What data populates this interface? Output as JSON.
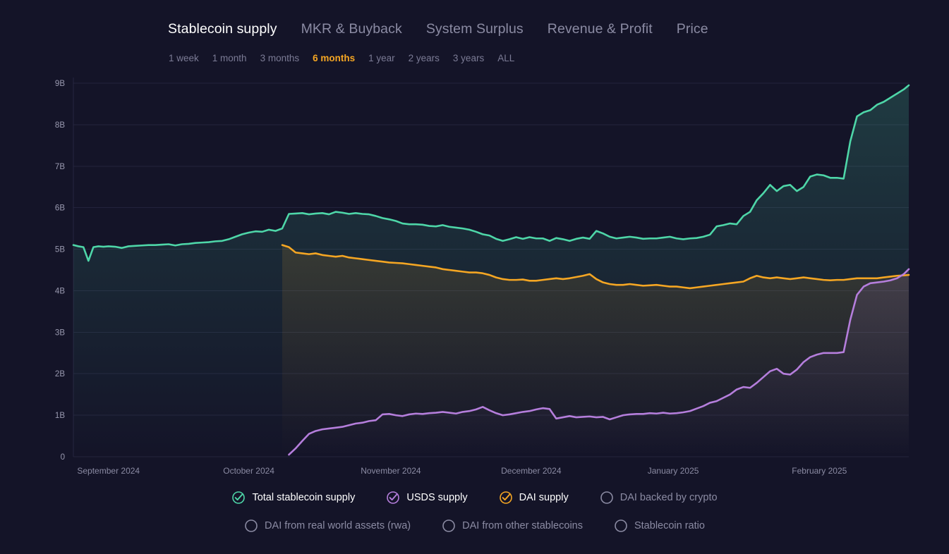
{
  "tabs": [
    {
      "label": "Stablecoin supply",
      "active": true
    },
    {
      "label": "MKR & Buyback",
      "active": false
    },
    {
      "label": "System Surplus",
      "active": false
    },
    {
      "label": "Revenue & Profit",
      "active": false
    },
    {
      "label": "Price",
      "active": false
    }
  ],
  "ranges": [
    {
      "label": "1 week",
      "active": false
    },
    {
      "label": "1 month",
      "active": false
    },
    {
      "label": "3 months",
      "active": false
    },
    {
      "label": "6 months",
      "active": true
    },
    {
      "label": "1 year",
      "active": false
    },
    {
      "label": "2 years",
      "active": false
    },
    {
      "label": "3 years",
      "active": false
    },
    {
      "label": "ALL",
      "active": false
    }
  ],
  "legend": {
    "row1": [
      {
        "label": "Total stablecoin supply",
        "active": true,
        "color": "#4ed6a8",
        "icon": "check-circle-icon"
      },
      {
        "label": "USDS supply",
        "active": true,
        "color": "#b57edc",
        "icon": "check-circle-icon"
      },
      {
        "label": "DAI supply",
        "active": true,
        "color": "#f5a623",
        "icon": "check-circle-icon"
      },
      {
        "label": "DAI backed by crypto",
        "active": false,
        "color": "#8b8ba3",
        "icon": "empty-circle-icon"
      }
    ],
    "row2": [
      {
        "label": "DAI from real world assets (rwa)",
        "active": false,
        "color": "#8b8ba3",
        "icon": "empty-circle-icon"
      },
      {
        "label": "DAI from other stablecoins",
        "active": false,
        "color": "#8b8ba3",
        "icon": "empty-circle-icon"
      },
      {
        "label": "Stablecoin ratio",
        "active": false,
        "color": "#8b8ba3",
        "icon": "empty-circle-icon"
      }
    ]
  },
  "colors": {
    "background": "#141428",
    "total": "#4ed6a8",
    "usds": "#b57edc",
    "dai": "#f5a623",
    "accent": "#f5a623",
    "grid": "#23233c",
    "axis_text": "#9a9ab0"
  },
  "chart_data": {
    "type": "line",
    "title": "Stablecoin supply",
    "xlabel": "",
    "ylabel": "",
    "ylim": [
      0,
      9
    ],
    "yticks": [
      0,
      1,
      2,
      3,
      4,
      5,
      6,
      7,
      8,
      9
    ],
    "ytick_labels": [
      "0",
      "1B",
      "2B",
      "3B",
      "4B",
      "5B",
      "6B",
      "7B",
      "8B",
      "9B"
    ],
    "xtick_labels": [
      "September 2024",
      "October 2024",
      "November 2024",
      "December 2024",
      "January 2025",
      "February 2025"
    ],
    "xtick_positions": [
      0.042,
      0.21,
      0.38,
      0.548,
      0.718,
      0.893
    ],
    "units": "USD billions",
    "grid": true,
    "legend_position": "bottom",
    "series": [
      {
        "name": "Total stablecoin supply",
        "color": "#4ed6a8",
        "x": [
          0,
          0.006,
          0.012,
          0.018,
          0.024,
          0.03,
          0.036,
          0.042,
          0.05,
          0.058,
          0.066,
          0.074,
          0.082,
          0.09,
          0.098,
          0.106,
          0.114,
          0.122,
          0.13,
          0.138,
          0.146,
          0.154,
          0.162,
          0.17,
          0.178,
          0.186,
          0.194,
          0.202,
          0.21,
          0.218,
          0.226,
          0.234,
          0.242,
          0.25,
          0.258,
          0.266,
          0.274,
          0.282,
          0.29,
          0.298,
          0.306,
          0.314,
          0.322,
          0.33,
          0.338,
          0.346,
          0.354,
          0.362,
          0.37,
          0.378,
          0.386,
          0.394,
          0.402,
          0.41,
          0.418,
          0.426,
          0.434,
          0.442,
          0.45,
          0.458,
          0.466,
          0.474,
          0.482,
          0.49,
          0.498,
          0.506,
          0.514,
          0.522,
          0.53,
          0.538,
          0.546,
          0.554,
          0.562,
          0.57,
          0.578,
          0.586,
          0.594,
          0.602,
          0.61,
          0.618,
          0.626,
          0.634,
          0.642,
          0.65,
          0.658,
          0.666,
          0.674,
          0.682,
          0.69,
          0.698,
          0.706,
          0.714,
          0.722,
          0.73,
          0.738,
          0.746,
          0.754,
          0.762,
          0.77,
          0.778,
          0.786,
          0.794,
          0.802,
          0.81,
          0.818,
          0.826,
          0.834,
          0.842,
          0.85,
          0.858,
          0.866,
          0.874,
          0.882,
          0.89,
          0.898,
          0.906,
          0.914,
          0.922,
          0.93,
          0.938,
          0.946,
          0.954,
          0.962,
          0.97,
          0.978,
          0.986,
          0.994,
          1.0
        ],
        "y": [
          5.1,
          5.07,
          5.05,
          4.72,
          5.05,
          5.07,
          5.06,
          5.07,
          5.06,
          5.03,
          5.07,
          5.08,
          5.09,
          5.1,
          5.1,
          5.11,
          5.12,
          5.09,
          5.12,
          5.13,
          5.15,
          5.16,
          5.17,
          5.19,
          5.2,
          5.24,
          5.3,
          5.36,
          5.4,
          5.43,
          5.42,
          5.47,
          5.44,
          5.5,
          5.85,
          5.86,
          5.87,
          5.84,
          5.86,
          5.87,
          5.84,
          5.9,
          5.88,
          5.85,
          5.87,
          5.85,
          5.84,
          5.8,
          5.75,
          5.72,
          5.68,
          5.62,
          5.6,
          5.6,
          5.59,
          5.56,
          5.55,
          5.58,
          5.54,
          5.52,
          5.5,
          5.47,
          5.42,
          5.36,
          5.33,
          5.25,
          5.2,
          5.24,
          5.29,
          5.25,
          5.29,
          5.26,
          5.26,
          5.2,
          5.27,
          5.24,
          5.2,
          5.25,
          5.28,
          5.25,
          5.44,
          5.38,
          5.3,
          5.26,
          5.28,
          5.3,
          5.28,
          5.25,
          5.26,
          5.26,
          5.28,
          5.3,
          5.26,
          5.24,
          5.26,
          5.27,
          5.3,
          5.35,
          5.55,
          5.58,
          5.62,
          5.6,
          5.8,
          5.9,
          6.18,
          6.35,
          6.55,
          6.4,
          6.52,
          6.55,
          6.4,
          6.5,
          6.75,
          6.8,
          6.78,
          6.72,
          6.72,
          6.7,
          7.6,
          8.2,
          8.3,
          8.35,
          8.48,
          8.55,
          8.65,
          8.75,
          8.85,
          8.95
        ]
      },
      {
        "name": "DAI supply",
        "color": "#f5a623",
        "x": [
          0.25,
          0.258,
          0.266,
          0.274,
          0.282,
          0.29,
          0.298,
          0.306,
          0.314,
          0.322,
          0.33,
          0.338,
          0.346,
          0.354,
          0.362,
          0.37,
          0.378,
          0.386,
          0.394,
          0.402,
          0.41,
          0.418,
          0.426,
          0.434,
          0.442,
          0.45,
          0.458,
          0.466,
          0.474,
          0.482,
          0.49,
          0.498,
          0.506,
          0.514,
          0.522,
          0.53,
          0.538,
          0.546,
          0.554,
          0.562,
          0.57,
          0.578,
          0.586,
          0.594,
          0.602,
          0.61,
          0.618,
          0.626,
          0.634,
          0.642,
          0.65,
          0.658,
          0.666,
          0.674,
          0.682,
          0.69,
          0.698,
          0.706,
          0.714,
          0.722,
          0.73,
          0.738,
          0.746,
          0.754,
          0.762,
          0.77,
          0.778,
          0.786,
          0.794,
          0.802,
          0.81,
          0.818,
          0.826,
          0.834,
          0.842,
          0.85,
          0.858,
          0.866,
          0.874,
          0.882,
          0.89,
          0.898,
          0.906,
          0.914,
          0.922,
          0.93,
          0.938,
          0.946,
          0.954,
          0.962,
          0.97,
          0.978,
          0.986,
          0.994,
          1.0
        ],
        "y": [
          5.1,
          5.05,
          4.92,
          4.9,
          4.88,
          4.9,
          4.86,
          4.84,
          4.82,
          4.84,
          4.8,
          4.78,
          4.76,
          4.74,
          4.72,
          4.7,
          4.68,
          4.67,
          4.66,
          4.64,
          4.62,
          4.6,
          4.58,
          4.56,
          4.52,
          4.5,
          4.48,
          4.46,
          4.44,
          4.44,
          4.42,
          4.38,
          4.32,
          4.28,
          4.26,
          4.26,
          4.27,
          4.24,
          4.24,
          4.26,
          4.28,
          4.3,
          4.28,
          4.3,
          4.33,
          4.36,
          4.4,
          4.28,
          4.2,
          4.16,
          4.14,
          4.14,
          4.16,
          4.14,
          4.12,
          4.13,
          4.14,
          4.12,
          4.1,
          4.1,
          4.08,
          4.06,
          4.08,
          4.1,
          4.12,
          4.14,
          4.16,
          4.18,
          4.2,
          4.22,
          4.3,
          4.36,
          4.32,
          4.3,
          4.32,
          4.3,
          4.28,
          4.3,
          4.32,
          4.3,
          4.28,
          4.26,
          4.25,
          4.26,
          4.26,
          4.28,
          4.3,
          4.3,
          4.3,
          4.3,
          4.32,
          4.34,
          4.36,
          4.37,
          4.38
        ]
      },
      {
        "name": "USDS supply",
        "color": "#b57edc",
        "x": [
          0.258,
          0.266,
          0.274,
          0.282,
          0.29,
          0.298,
          0.306,
          0.314,
          0.322,
          0.33,
          0.338,
          0.346,
          0.354,
          0.362,
          0.37,
          0.378,
          0.386,
          0.394,
          0.402,
          0.41,
          0.418,
          0.426,
          0.434,
          0.442,
          0.45,
          0.458,
          0.466,
          0.474,
          0.482,
          0.49,
          0.498,
          0.506,
          0.514,
          0.522,
          0.53,
          0.538,
          0.546,
          0.554,
          0.562,
          0.57,
          0.578,
          0.586,
          0.594,
          0.602,
          0.61,
          0.618,
          0.626,
          0.634,
          0.642,
          0.65,
          0.658,
          0.666,
          0.674,
          0.682,
          0.69,
          0.698,
          0.706,
          0.714,
          0.722,
          0.73,
          0.738,
          0.746,
          0.754,
          0.762,
          0.77,
          0.778,
          0.786,
          0.794,
          0.802,
          0.81,
          0.818,
          0.826,
          0.834,
          0.842,
          0.85,
          0.858,
          0.866,
          0.874,
          0.882,
          0.89,
          0.898,
          0.906,
          0.914,
          0.922,
          0.93,
          0.938,
          0.946,
          0.954,
          0.962,
          0.97,
          0.978,
          0.986,
          0.994,
          1.0
        ],
        "y": [
          0.05,
          0.2,
          0.38,
          0.55,
          0.62,
          0.66,
          0.68,
          0.7,
          0.72,
          0.76,
          0.8,
          0.82,
          0.86,
          0.88,
          1.02,
          1.03,
          1.0,
          0.98,
          1.02,
          1.04,
          1.03,
          1.05,
          1.06,
          1.08,
          1.06,
          1.04,
          1.08,
          1.1,
          1.14,
          1.2,
          1.12,
          1.05,
          1.0,
          1.02,
          1.05,
          1.08,
          1.1,
          1.14,
          1.17,
          1.15,
          0.92,
          0.95,
          0.98,
          0.95,
          0.96,
          0.97,
          0.95,
          0.96,
          0.9,
          0.95,
          1.0,
          1.02,
          1.03,
          1.03,
          1.05,
          1.04,
          1.06,
          1.04,
          1.05,
          1.07,
          1.1,
          1.16,
          1.22,
          1.3,
          1.34,
          1.42,
          1.5,
          1.62,
          1.68,
          1.66,
          1.78,
          1.92,
          2.06,
          2.12,
          2.0,
          1.98,
          2.1,
          2.28,
          2.4,
          2.46,
          2.5,
          2.5,
          2.5,
          2.52,
          3.3,
          3.9,
          4.1,
          4.18,
          4.2,
          4.22,
          4.25,
          4.3,
          4.4,
          4.52
        ]
      }
    ]
  }
}
